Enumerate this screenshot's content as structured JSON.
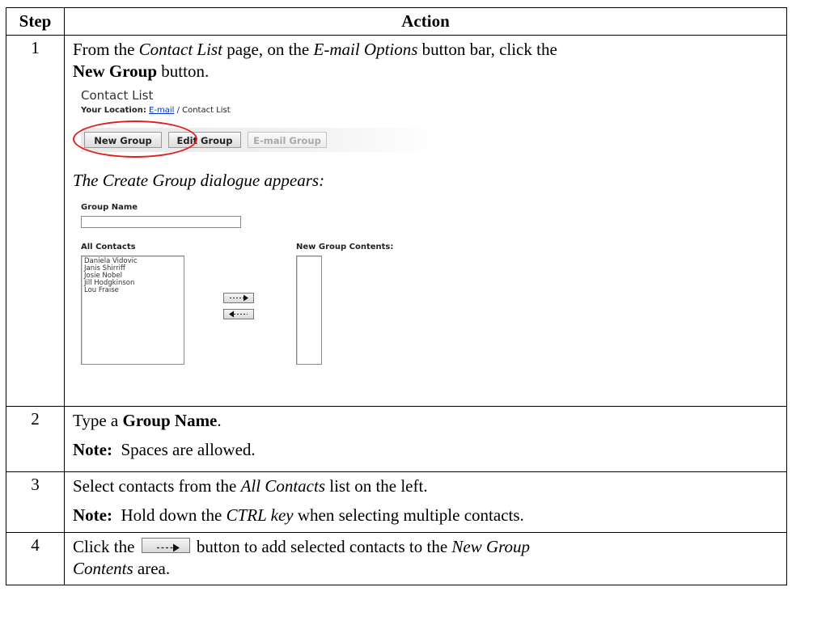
{
  "table": {
    "headers": {
      "step": "Step",
      "action": "Action"
    }
  },
  "step1": {
    "number": "1",
    "text_a": "From the ",
    "text_b": "Contact List",
    "text_c": " page, on the ",
    "text_d": "E-mail Options",
    "text_e": " button bar, click the",
    "text_f": "New Group",
    "text_g": " button.",
    "contact_list": {
      "title": "Contact List",
      "location_label": "Your Location:",
      "location_link": "E-mail",
      "location_rest": " / Contact List",
      "buttons": {
        "new_group": "New Group",
        "edit_group": "Edit Group",
        "email_group": "E-mail Group"
      }
    },
    "dialogue_intro": "The Create Group dialogue appears:",
    "dialogue": {
      "group_name_label": "Group Name",
      "all_contacts_label": "All Contacts",
      "new_group_contents_label": "New Group Contents:",
      "contacts": [
        "Daniela Vidovic",
        "Janis Shirriff",
        "Josie Nobel",
        "Jill Hodgkinson",
        "Lou Fraise"
      ],
      "add_icon": "dotted-right-arrow-icon",
      "remove_icon": "dotted-left-arrow-icon"
    }
  },
  "step2": {
    "number": "2",
    "text_a": "Type a ",
    "text_b": "Group Name",
    "text_c": ".",
    "note_label": "Note:",
    "note_text": "  Spaces are allowed."
  },
  "step3": {
    "number": "3",
    "text_a": "Select contacts from the ",
    "text_b": "All Contacts",
    "text_c": " list on the left.",
    "note_label": "Note:",
    "note_text_a": "  Hold down the ",
    "note_text_b": "CTRL key",
    "note_text_c": " when selecting multiple contacts."
  },
  "step4": {
    "number": "4",
    "text_a": "Click the ",
    "text_b": " button to add selected contacts to the ",
    "text_c": "New Group",
    "text_d": "Contents",
    "text_e": " area.",
    "button_icon": "dotted-right-arrow-icon"
  }
}
